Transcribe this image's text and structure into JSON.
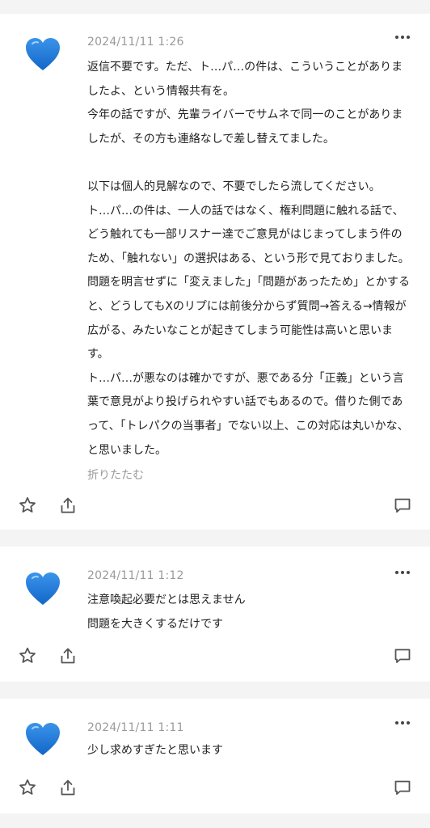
{
  "comments": [
    {
      "avatar_icon": "blue-heart-icon",
      "timestamp": "2024/11/11 1:26",
      "body_lines": [
        "返信不要です。ただ、ト…パ…の件は、こういうことがありましたよ、という情報共有を。",
        "今年の話ですが、先輩ライバーでサムネで同一のことがありましたが、その方も連絡なしで差し替えてました。",
        "",
        "以下は個人的見解なので、不要でしたら流してください。",
        "ト…パ…の件は、一人の話ではなく、権利問題に触れる話で、どう触れても一部リスナー達でご意見がはじまってしまう件のため、「触れない」の選択はある、という形で見ておりました。問題を明言せずに「変えました」「問題があったため」とかすると、どうしてもXのリプには前後分からず質問→答える→情報が広がる、みたいなことが起きてしまう可能性は高いと思います。",
        "ト…パ…が悪なのは確かですが、悪である分「正義」という言葉で意見がより投げられやすい話でもあるので。借りた側であって、「トレパクの当事者」でない以上、この対応は丸いかな、と思いました。"
      ],
      "collapse_label": "折りたたむ"
    },
    {
      "avatar_icon": "blue-heart-icon",
      "timestamp": "2024/11/11 1:12",
      "body_lines": [
        "注意喚起必要だとは思えません",
        "問題を大きくするだけです"
      ]
    },
    {
      "avatar_icon": "blue-heart-icon",
      "timestamp": "2024/11/11 1:11",
      "body_lines": [
        "少し求めすぎたと思います"
      ]
    }
  ],
  "colors": {
    "heart": "#1877d8",
    "meta_text": "#9a9a9a",
    "icon_gray": "#555555",
    "page_bg": "#f4f4f4"
  },
  "action_icons": [
    "star-icon",
    "share-icon",
    "comment-icon"
  ]
}
